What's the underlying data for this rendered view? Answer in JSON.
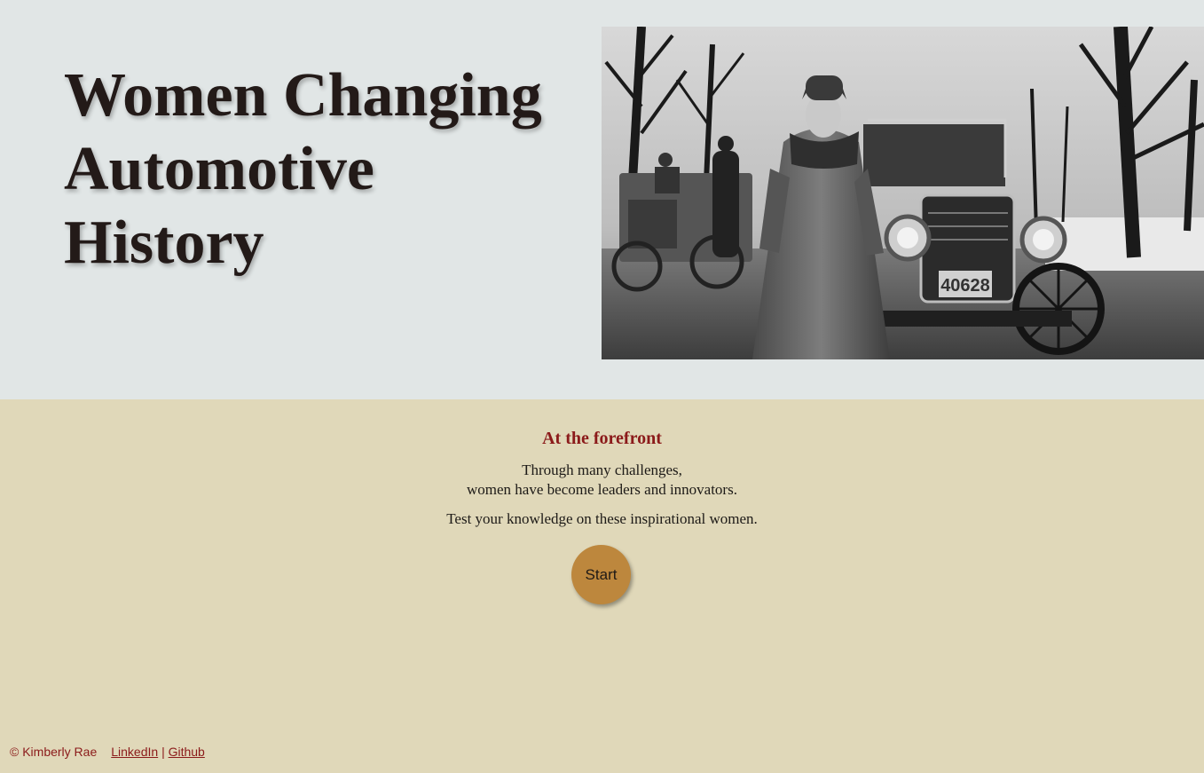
{
  "hero": {
    "title_line1": "Women Changing",
    "title_line2": "Automotive",
    "title_line3": "History",
    "photo_license_plate": "40628"
  },
  "main": {
    "heading": "At the forefront",
    "intro_line1": "Through many challenges,",
    "intro_line2": "women have become leaders and innovators.",
    "prompt": "Test your knowledge on these inspirational women.",
    "start_label": "Start"
  },
  "footer": {
    "copyright": "© Kimberly Rae",
    "linkedin_label": "LinkedIn",
    "separator": "|",
    "github_label": "Github"
  },
  "colors": {
    "hero_background": "#e1e6e6",
    "page_background": "#e0d8b9",
    "accent_red": "#8b1a1a",
    "button": "#bd873d",
    "title_text": "#231a18"
  }
}
